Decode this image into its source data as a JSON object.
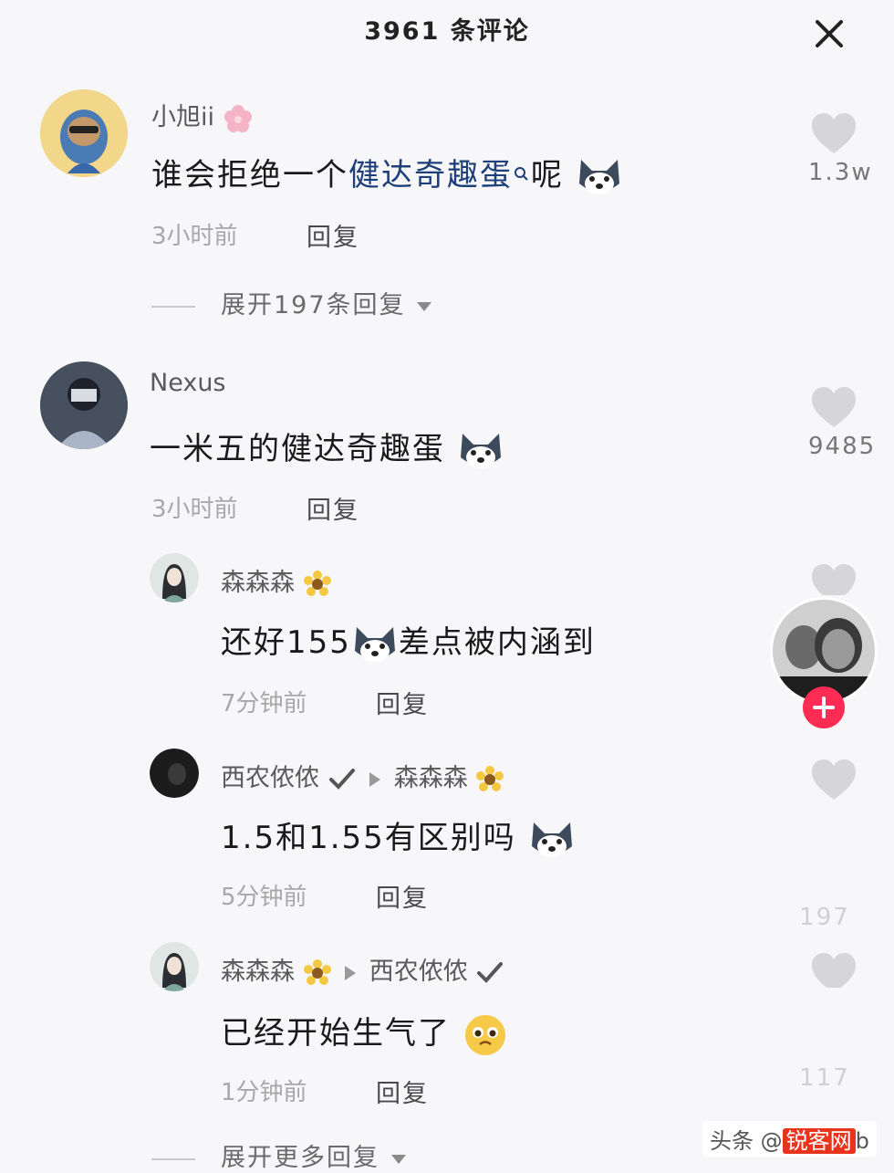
{
  "header": {
    "title": "3961 条评论"
  },
  "comments": [
    {
      "username": "小旭ii",
      "text_before": "谁会拒绝一个",
      "text_link": "健达奇趣蛋",
      "text_after": "呢",
      "time": "3小时前",
      "reply": "回复",
      "likes": "1.3w",
      "expand": "展开197条回复"
    },
    {
      "username": "Nexus",
      "text": "一米五的健达奇趣蛋",
      "time": "3小时前",
      "reply": "回复",
      "likes": "9485"
    }
  ],
  "replies": [
    {
      "username": "森森森",
      "text_before": "还好155",
      "text_after": "差点被内涵到",
      "time": "7分钟前",
      "reply": "回复"
    },
    {
      "username": "西农侬侬",
      "reply_to": "森森森",
      "text": "1.5和1.55有区别吗",
      "time": "5分钟前",
      "reply": "回复",
      "likes": "197"
    },
    {
      "username": "森森森",
      "reply_to": "西农侬侬",
      "text": "已经开始生气了",
      "time": "1分钟前",
      "reply": "回复",
      "likes": "117"
    }
  ],
  "expand_more": "展开更多回复",
  "watermark": {
    "prefix": "头条 @",
    "brand": "锐客网",
    "suffix": "b"
  },
  "colors": {
    "link": "#1d3f7a",
    "accent": "#fe2c55",
    "heart": "#d6d6d8"
  }
}
